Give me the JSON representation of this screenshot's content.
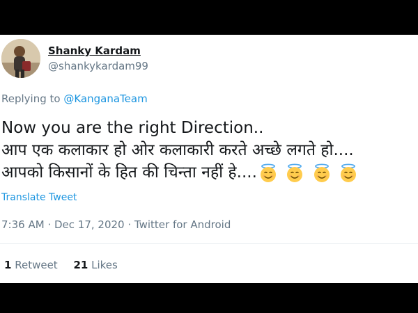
{
  "author": {
    "name": "Shanky Kardam",
    "handle": "@shankykardam99"
  },
  "reply": {
    "prefix": "Replying to",
    "mention": "@KanganaTeam"
  },
  "tweet": {
    "lines": [
      "Now you are the right Direction..",
      "आप एक कलाकार हो ओर कलाकारी करते अच्छे लगते हो....",
      "आपको किसानों के हित की चिन्ता नहीं हे...."
    ],
    "emojis": [
      "smiling-face-with-halo-icon",
      "smiling-face-with-halo-icon",
      "smiling-face-with-halo-icon",
      "smiling-face-with-halo-icon"
    ]
  },
  "translate_label": "Translate Tweet",
  "meta": {
    "time": "7:36 AM",
    "date": "Dec 17, 2020",
    "source": "Twitter for Android"
  },
  "stats": {
    "retweets_count": "1",
    "retweets_label": "Retweet",
    "likes_count": "21",
    "likes_label": "Likes"
  },
  "colors": {
    "link": "#1b95e0",
    "secondary_text": "#657786",
    "primary_text": "#14171a"
  }
}
